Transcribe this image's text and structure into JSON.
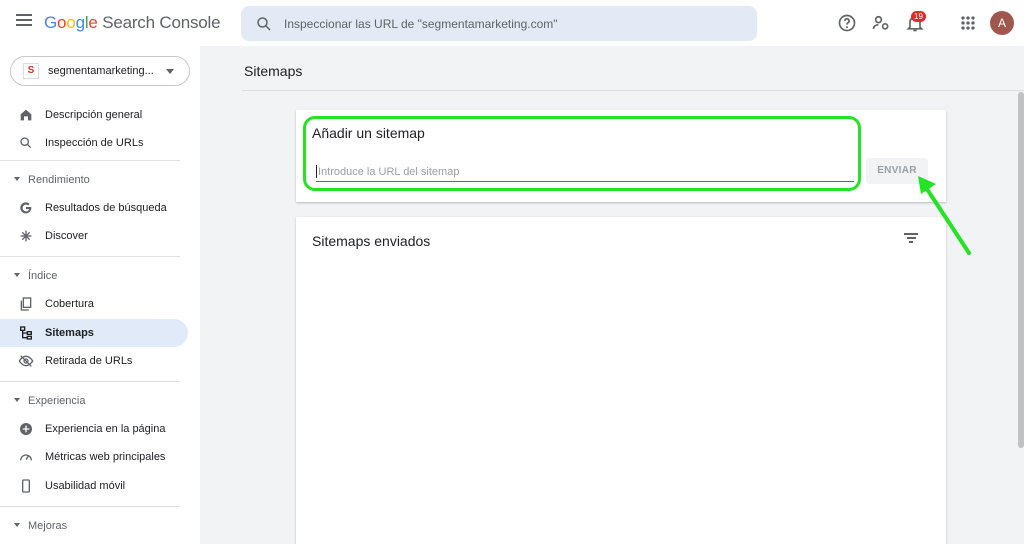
{
  "header": {
    "logo_google": [
      "G",
      "o",
      "o",
      "g",
      "l",
      "e"
    ],
    "logo_product": "Search Console",
    "search_placeholder": "Inspeccionar las URL de \"segmentamarketing.com\"",
    "notifications_count": "19",
    "avatar_initial": "A"
  },
  "sidebar": {
    "property": {
      "logo_letter": "S",
      "name": "segmentamarketing..."
    },
    "items": [
      {
        "label": "Descripción general",
        "icon": "home-icon"
      },
      {
        "label": "Inspección de URLs",
        "icon": "search-icon"
      }
    ],
    "sections": [
      {
        "label": "Rendimiento",
        "items": [
          {
            "label": "Resultados de búsqueda",
            "icon": "google-g-icon"
          },
          {
            "label": "Discover",
            "icon": "asterisk-icon"
          }
        ]
      },
      {
        "label": "Índice",
        "items": [
          {
            "label": "Cobertura",
            "icon": "file-copy-icon"
          },
          {
            "label": "Sitemaps",
            "icon": "sitemap-icon",
            "active": true
          },
          {
            "label": "Retirada de URLs",
            "icon": "eye-off-icon"
          }
        ]
      },
      {
        "label": "Experiencia",
        "items": [
          {
            "label": "Experiencia en la página",
            "icon": "plus-circle-icon"
          },
          {
            "label": "Métricas web principales",
            "icon": "speedometer-icon"
          },
          {
            "label": "Usabilidad móvil",
            "icon": "phone-icon"
          }
        ]
      },
      {
        "label": "Mejoras",
        "items": []
      }
    ]
  },
  "main": {
    "page_title": "Sitemaps",
    "add_card": {
      "title": "Añadir un sitemap",
      "input_placeholder": "Introduce la URL del sitemap",
      "submit_label": "ENVIAR"
    },
    "submitted_card": {
      "title": "Sitemaps enviados"
    }
  },
  "colors": {
    "accent": "#1a73e8",
    "annotation": "#24e224",
    "active_nav_bg": "#e0eaf8",
    "badge": "#d93025"
  }
}
